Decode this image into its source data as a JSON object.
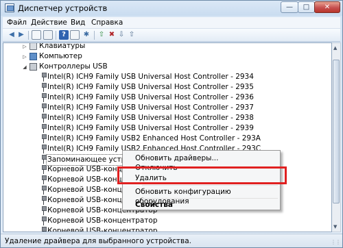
{
  "window": {
    "title": "Диспетчер устройств"
  },
  "menubar": {
    "items": [
      "Файл",
      "Действие",
      "Вид",
      "Справка"
    ]
  },
  "toolbar": {
    "buttons": [
      "back-icon",
      "forward-icon",
      "view-icon",
      "properties-icon",
      "help-icon",
      "scan-icon",
      "update-driver-icon",
      "uninstall-icon",
      "disable-icon",
      "enable-icon"
    ]
  },
  "tree": {
    "keyboards": "Клавиатуры",
    "computer": "Компьютер",
    "usb_controllers": "Контроллеры USB",
    "usb_children": [
      "Intel(R) ICH9 Family USB Universal Host Controller - 2934",
      "Intel(R) ICH9 Family USB Universal Host Controller - 2935",
      "Intel(R) ICH9 Family USB Universal Host Controller - 2936",
      "Intel(R) ICH9 Family USB Universal Host Controller - 2937",
      "Intel(R) ICH9 Family USB Universal Host Controller - 2938",
      "Intel(R) ICH9 Family USB Universal Host Controller - 2939",
      "Intel(R) ICH9 Family USB2 Enhanced Host Controller - 293A",
      "Intel(R) ICH9 Family USB2 Enhanced Host Controller - 293C",
      "Запоминающее устройство для USB",
      "Корневой USB-концентратор",
      "Корневой USB-концентратор",
      "Корневой USB-концентратор",
      "Корневой USB-концентратор",
      "Корневой USB-концентратор",
      "Корневой USB-концентратор",
      "Корневой USB-концентратор",
      "Корневой USB-концентратор"
    ]
  },
  "context_menu": {
    "update_driver": "Обновить драйверы...",
    "disable": "Отключить",
    "uninstall": "Удалить",
    "scan": "Обновить конфигурацию оборудования",
    "properties": "Свойства"
  },
  "statusbar": {
    "text": "Удаление драйвера для выбранного устройства."
  },
  "colors": {
    "highlight": "#e02020",
    "window_frame": "#c9dcf0"
  }
}
